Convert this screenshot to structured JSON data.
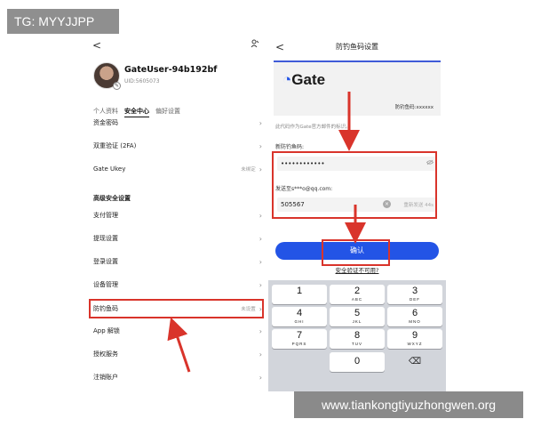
{
  "watermarks": {
    "top": "TG: MYYJJPP",
    "bottom": "www.tiankongtiyuzhongwen.org"
  },
  "left_panel": {
    "back_glyph": "<",
    "person_icon": "person-icon",
    "user": {
      "name": "GateUser-94b192bf",
      "uid": "UID:5605073"
    },
    "tabs": [
      {
        "label": "个人资料",
        "active": false
      },
      {
        "label": "安全中心",
        "active": true
      },
      {
        "label": "偏好设置",
        "active": false
      }
    ],
    "items": [
      {
        "label": "资金密码",
        "sub": ""
      },
      {
        "label": "双重验证 (2FA)",
        "sub": ""
      },
      {
        "label": "Gate Ukey",
        "sub": "未绑定"
      }
    ],
    "section_title": "高级安全设置",
    "advanced_items": [
      {
        "label": "支付管理",
        "sub": ""
      },
      {
        "label": "提现设置",
        "sub": ""
      },
      {
        "label": "登录设置",
        "sub": ""
      },
      {
        "label": "设备管理",
        "sub": ""
      },
      {
        "label": "防钓鱼码",
        "sub": "未设置"
      },
      {
        "label": "App 解锁",
        "sub": ""
      },
      {
        "label": "授权服务",
        "sub": ""
      },
      {
        "label": "注销账户",
        "sub": ""
      }
    ]
  },
  "right_panel": {
    "back_glyph": "<",
    "title": "防钓鱼码设置",
    "brand": "Gate",
    "code_label": "防钓鱼码:xxxxxx",
    "description": "此代码作为Gate官方邮件的标识。",
    "new_code_label": "新防钓鱼码:",
    "new_code_value": "••••••••••••",
    "send_to_label": "发送至s***o@qq.com:",
    "verify_code_value": "505567",
    "resend_label": "重新发送 44s",
    "confirm_label": "确认",
    "unavailable_link": "安全验证不可用?"
  },
  "keypad": {
    "keys": [
      {
        "num": "1",
        "letters": ""
      },
      {
        "num": "2",
        "letters": "ABC"
      },
      {
        "num": "3",
        "letters": "DEF"
      },
      {
        "num": "4",
        "letters": "GHI"
      },
      {
        "num": "5",
        "letters": "JKL"
      },
      {
        "num": "6",
        "letters": "MNO"
      },
      {
        "num": "7",
        "letters": "PQRS"
      },
      {
        "num": "8",
        "letters": "TUV"
      },
      {
        "num": "9",
        "letters": "WXYZ"
      },
      {
        "num": "0",
        "letters": ""
      }
    ],
    "delete_glyph": "⌫"
  },
  "colors": {
    "accent": "#2354e6",
    "highlight": "#d9342b",
    "keypad_bg": "#d2d5db"
  }
}
